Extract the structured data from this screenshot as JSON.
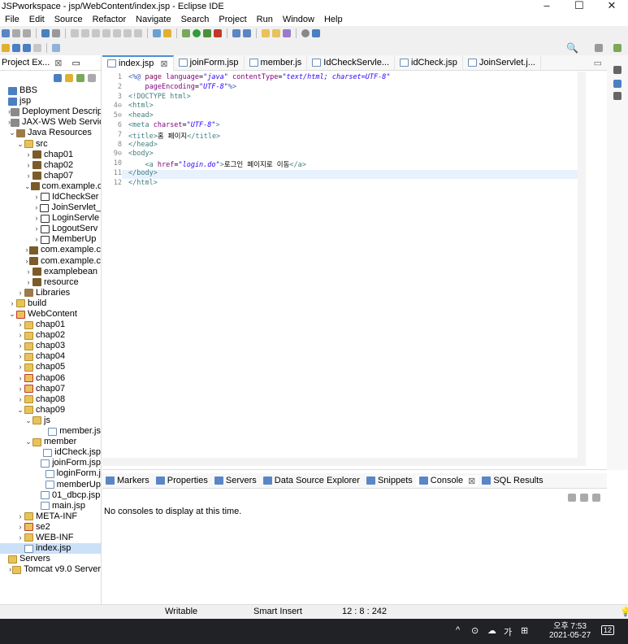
{
  "window": {
    "title": "JSPworkspace - jsp/WebContent/index.jsp - Eclipse IDE",
    "minimize": "–",
    "maximize": "☐",
    "close": "✕"
  },
  "menu": [
    "File",
    "Edit",
    "Source",
    "Refactor",
    "Navigate",
    "Search",
    "Project",
    "Run",
    "Window",
    "Help"
  ],
  "explorer": {
    "title": "Project Ex...",
    "close": "⊠",
    "items": [
      {
        "t": "BBS",
        "i": "proj",
        "d": 0,
        "tw": ""
      },
      {
        "t": "jsp",
        "i": "proj",
        "d": 0,
        "tw": ""
      },
      {
        "t": "Deployment Descrip",
        "i": "jar",
        "d": 1,
        "tw": ">"
      },
      {
        "t": "JAX-WS Web Service",
        "i": "jar",
        "d": 1,
        "tw": ">"
      },
      {
        "t": "Java Resources",
        "i": "lib",
        "d": 1,
        "tw": "v"
      },
      {
        "t": "src",
        "i": "folder",
        "d": 2,
        "tw": "v"
      },
      {
        "t": "chap01",
        "i": "pkg",
        "d": 3,
        "tw": ">"
      },
      {
        "t": "chap02",
        "i": "pkg",
        "d": 3,
        "tw": ">"
      },
      {
        "t": "chap07",
        "i": "pkg",
        "d": 3,
        "tw": ">"
      },
      {
        "t": "com.example.c",
        "i": "pkg",
        "d": 3,
        "tw": "v"
      },
      {
        "t": "IdCheckSer",
        "i": "java",
        "d": 4,
        "tw": ">"
      },
      {
        "t": "JoinServlet_",
        "i": "java",
        "d": 4,
        "tw": ">"
      },
      {
        "t": "LoginServle",
        "i": "java",
        "d": 4,
        "tw": ">"
      },
      {
        "t": "LogoutServ",
        "i": "java",
        "d": 4,
        "tw": ">"
      },
      {
        "t": "MemberUp",
        "i": "java",
        "d": 4,
        "tw": ">"
      },
      {
        "t": "com.example.c",
        "i": "pkg",
        "d": 3,
        "tw": ">"
      },
      {
        "t": "com.example.c",
        "i": "pkg",
        "d": 3,
        "tw": ">"
      },
      {
        "t": "examplebean",
        "i": "pkg",
        "d": 3,
        "tw": ">"
      },
      {
        "t": "resource",
        "i": "pkg",
        "d": 3,
        "tw": ">"
      },
      {
        "t": "Libraries",
        "i": "lib",
        "d": 2,
        "tw": ">"
      },
      {
        "t": "build",
        "i": "folder",
        "d": 1,
        "tw": ">"
      },
      {
        "t": "WebContent",
        "i": "fred",
        "d": 1,
        "tw": "v"
      },
      {
        "t": "chap01",
        "i": "folder",
        "d": 2,
        "tw": ">"
      },
      {
        "t": "chap02",
        "i": "folder",
        "d": 2,
        "tw": ">"
      },
      {
        "t": "chap03",
        "i": "folder",
        "d": 2,
        "tw": ">"
      },
      {
        "t": "chap04",
        "i": "folder",
        "d": 2,
        "tw": ">"
      },
      {
        "t": "chap05",
        "i": "folder",
        "d": 2,
        "tw": ">"
      },
      {
        "t": "chap06",
        "i": "fred",
        "d": 2,
        "tw": ">"
      },
      {
        "t": "chap07",
        "i": "fred",
        "d": 2,
        "tw": ">"
      },
      {
        "t": "chap08",
        "i": "folder",
        "d": 2,
        "tw": ">"
      },
      {
        "t": "chap09",
        "i": "folder",
        "d": 2,
        "tw": "v"
      },
      {
        "t": "js",
        "i": "folder",
        "d": 3,
        "tw": "v"
      },
      {
        "t": "member.js",
        "i": "file",
        "d": 5,
        "tw": ""
      },
      {
        "t": "member",
        "i": "folder",
        "d": 3,
        "tw": "v"
      },
      {
        "t": "idCheck.jsp",
        "i": "file",
        "d": 5,
        "tw": ""
      },
      {
        "t": "joinForm.jsp",
        "i": "file",
        "d": 5,
        "tw": ""
      },
      {
        "t": "loginForm.j",
        "i": "file",
        "d": 5,
        "tw": ""
      },
      {
        "t": "memberUp",
        "i": "file",
        "d": 5,
        "tw": ""
      },
      {
        "t": "01_dbcp.jsp",
        "i": "file",
        "d": 4,
        "tw": ""
      },
      {
        "t": "main.jsp",
        "i": "file",
        "d": 4,
        "tw": ""
      },
      {
        "t": "META-INF",
        "i": "folder",
        "d": 2,
        "tw": ">"
      },
      {
        "t": "se2",
        "i": "fred",
        "d": 2,
        "tw": ">"
      },
      {
        "t": "WEB-INF",
        "i": "folder",
        "d": 2,
        "tw": ">"
      },
      {
        "t": "index.jsp",
        "i": "file",
        "d": 2,
        "tw": "",
        "sel": true
      },
      {
        "t": "Servers",
        "i": "folder",
        "d": 0,
        "tw": ""
      },
      {
        "t": "Tomcat v9.0 Server",
        "i": "folder",
        "d": 1,
        "tw": ">"
      }
    ]
  },
  "editor": {
    "tabs": [
      {
        "label": "index.jsp",
        "close": "⊠",
        "active": true
      },
      {
        "label": "joinForm.jsp"
      },
      {
        "label": "member.js"
      },
      {
        "label": "IdCheckServle..."
      },
      {
        "label": "idCheck.jsp"
      },
      {
        "label": "JoinServlet.j..."
      }
    ],
    "code": [
      {
        "n": "1",
        "h": "<span class=cm>&lt;%@</span> <span class=kw>page</span> <span class=at>language</span>=<span class=st>\"java\"</span> <span class=at>contentType</span>=<span class=st>\"text/html; charset=UTF-8\"</span>"
      },
      {
        "n": "2",
        "h": "    <span class=at>pageEncoding</span>=<span class=st>\"UTF-8\"</span><span class=cm>%&gt;</span>"
      },
      {
        "n": "3",
        "h": "<span class=tag>&lt;!DOCTYPE html&gt;</span>"
      },
      {
        "n": "4⊖",
        "h": "<span class=tag>&lt;html&gt;</span>"
      },
      {
        "n": "5⊖",
        "h": "<span class=tag>&lt;head&gt;</span>"
      },
      {
        "n": "6",
        "h": "<span class=tag>&lt;meta</span> <span class=at>charset</span>=<span class=st>\"UTF-8\"</span><span class=tag>&gt;</span>"
      },
      {
        "n": "7",
        "h": "<span class=tag>&lt;title&gt;</span>홈 페이지<span class=tag>&lt;/title&gt;</span>"
      },
      {
        "n": "8",
        "h": "<span class=tag>&lt;/head&gt;</span>"
      },
      {
        "n": "9⊖",
        "h": "<span class=tag>&lt;body&gt;</span>"
      },
      {
        "n": "10",
        "h": "    <span class=tag>&lt;a</span> <span class=at>href</span>=<span class=st>\"login.do\"</span><span class=tag>&gt;</span>로그인 페이지로 이동<span class=tag>&lt;/a&gt;</span>"
      },
      {
        "n": "11",
        "h": "<span class=tag>&lt;/body&gt;</span>"
      },
      {
        "n": "12",
        "h": "<span class=tag>&lt;/html&gt;</span>"
      }
    ]
  },
  "bottom": {
    "tabs": [
      {
        "label": "Markers"
      },
      {
        "label": "Properties"
      },
      {
        "label": "Servers"
      },
      {
        "label": "Data Source Explorer"
      },
      {
        "label": "Snippets"
      },
      {
        "label": "Console",
        "active": true,
        "close": "⊠"
      },
      {
        "label": "SQL Results"
      }
    ],
    "message": "No consoles to display at this time."
  },
  "status": {
    "writable": "Writable",
    "insert": "Smart Insert",
    "position": "12 : 8 : 242"
  },
  "taskbar": {
    "time": "오후 7:53",
    "date": "2021-05-27",
    "ime": "가",
    "badge": "12"
  }
}
